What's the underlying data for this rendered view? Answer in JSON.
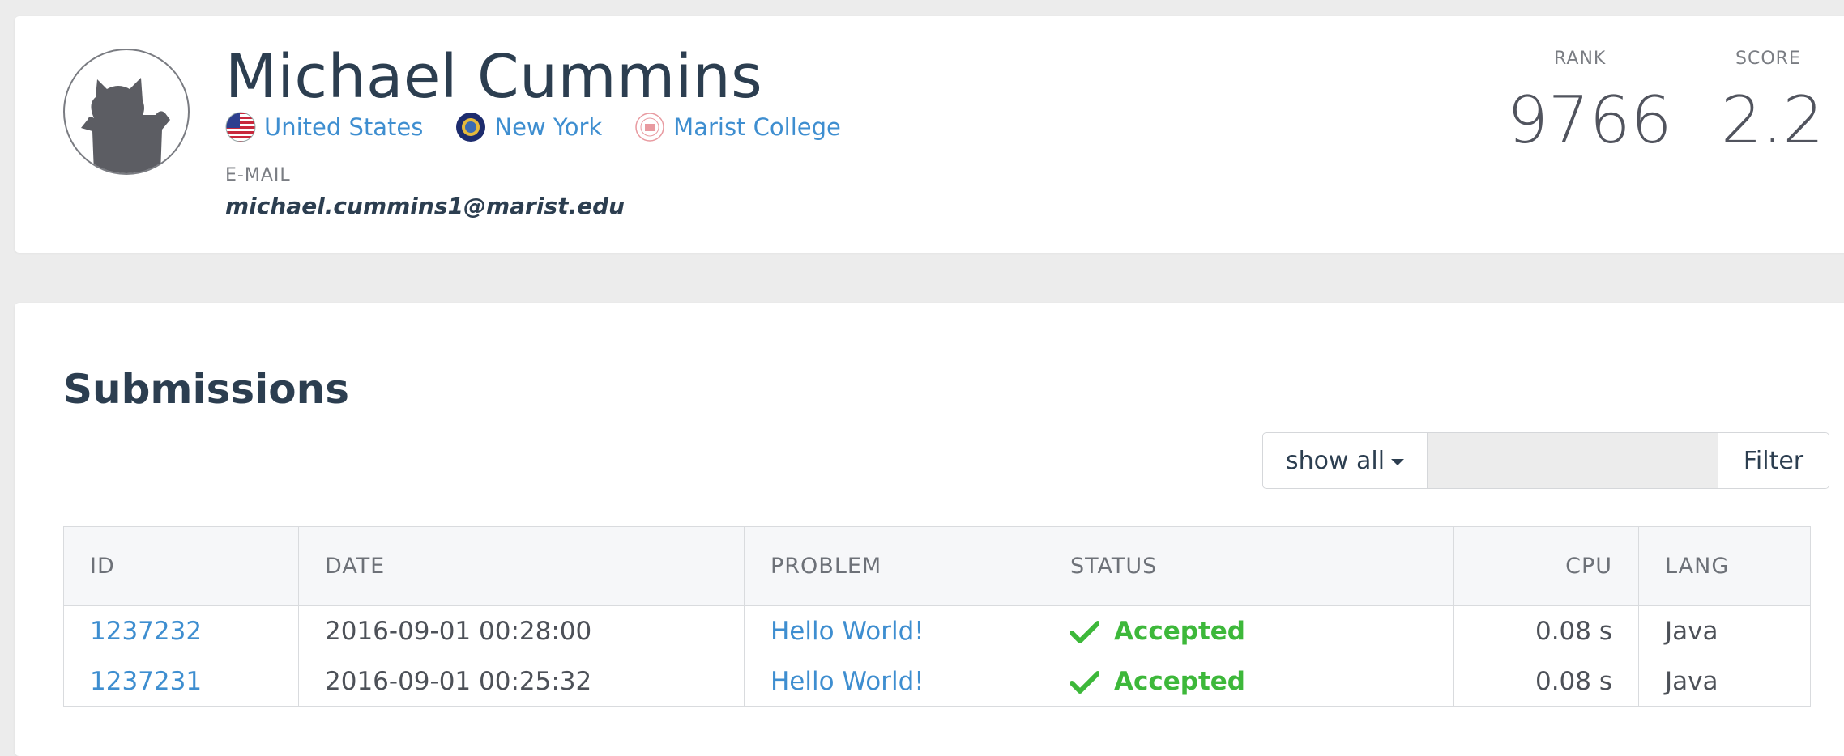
{
  "profile": {
    "name": "Michael Cummins",
    "affiliations": [
      {
        "label": "United States",
        "icon": "us-flag-icon"
      },
      {
        "label": "New York",
        "icon": "new-york-seal-icon"
      },
      {
        "label": "Marist College",
        "icon": "marist-college-seal-icon"
      }
    ],
    "email_label": "E-MAIL",
    "email": "michael.cummins1@marist.edu",
    "rank_label": "RANK",
    "rank": "9766",
    "score_label": "SCORE",
    "score": "2.2"
  },
  "submissions": {
    "title": "Submissions",
    "filter": {
      "dropdown_label": "show all",
      "input_value": "",
      "button_label": "Filter"
    },
    "columns": [
      "ID",
      "DATE",
      "PROBLEM",
      "STATUS",
      "CPU",
      "LANG"
    ],
    "rows": [
      {
        "id": "1237232",
        "date": "2016-09-01 00:28:00",
        "problem": "Hello World!",
        "status": "Accepted",
        "cpu": "0.08 s",
        "lang": "Java"
      },
      {
        "id": "1237231",
        "date": "2016-09-01 00:25:32",
        "problem": "Hello World!",
        "status": "Accepted",
        "cpu": "0.08 s",
        "lang": "Java"
      }
    ]
  },
  "colors": {
    "link": "#3e8ed0",
    "accepted": "#3db83a",
    "heading": "#2c3e50"
  }
}
